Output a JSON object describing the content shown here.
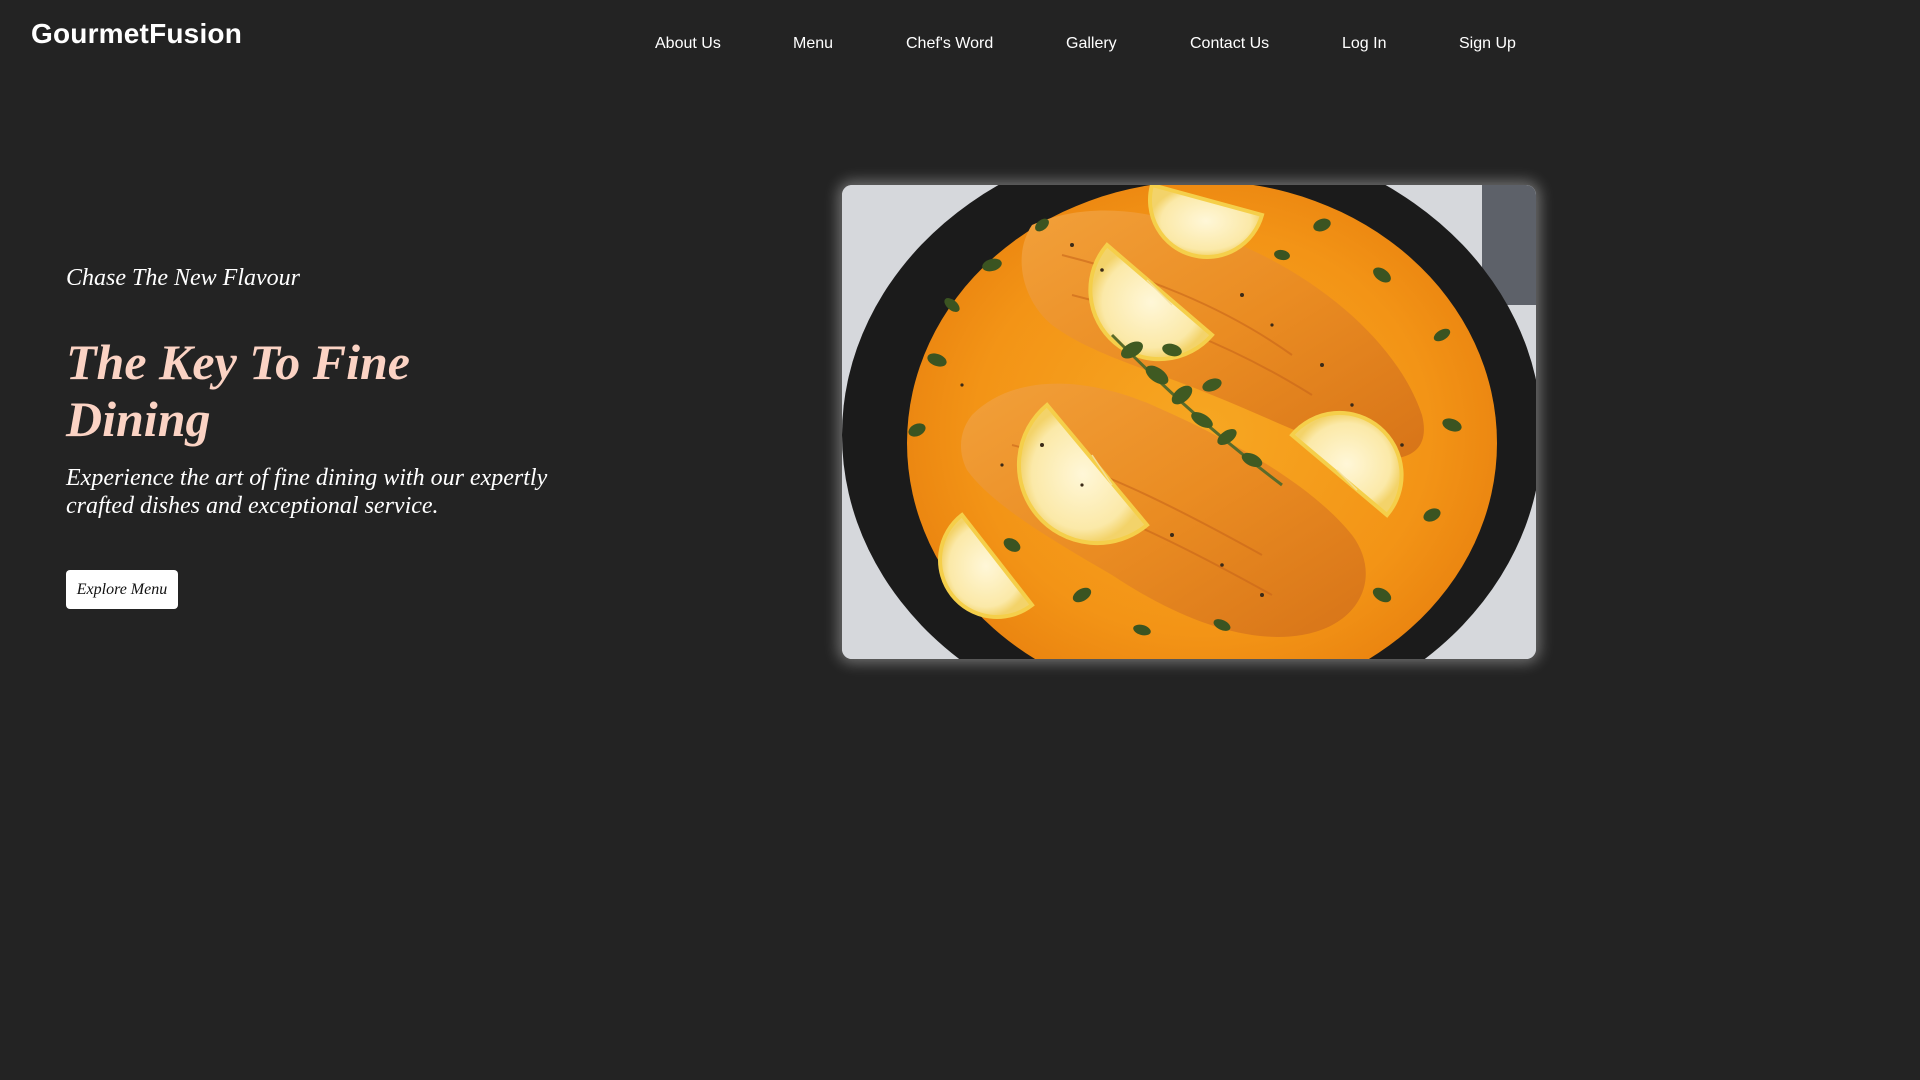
{
  "header": {
    "logo": "GourmetFusion"
  },
  "nav": {
    "items": [
      {
        "label": "About Us"
      },
      {
        "label": "Menu"
      },
      {
        "label": "Chef's Word"
      },
      {
        "label": "Gallery"
      },
      {
        "label": "Contact Us"
      },
      {
        "label": "Log In"
      },
      {
        "label": "Sign Up"
      }
    ]
  },
  "hero": {
    "tagline": "Chase The New Flavour",
    "headline": "The Key To Fine Dining",
    "description": "Experience the art of fine dining with our expertly crafted dishes and exceptional service.",
    "cta_label": "Explore Menu",
    "image_icon": "salmon-dish-photo"
  },
  "colors": {
    "background": "#232323",
    "headline": "#fbd3c4",
    "sauce": "#f59a1b",
    "pan": "#1b1b1b"
  }
}
